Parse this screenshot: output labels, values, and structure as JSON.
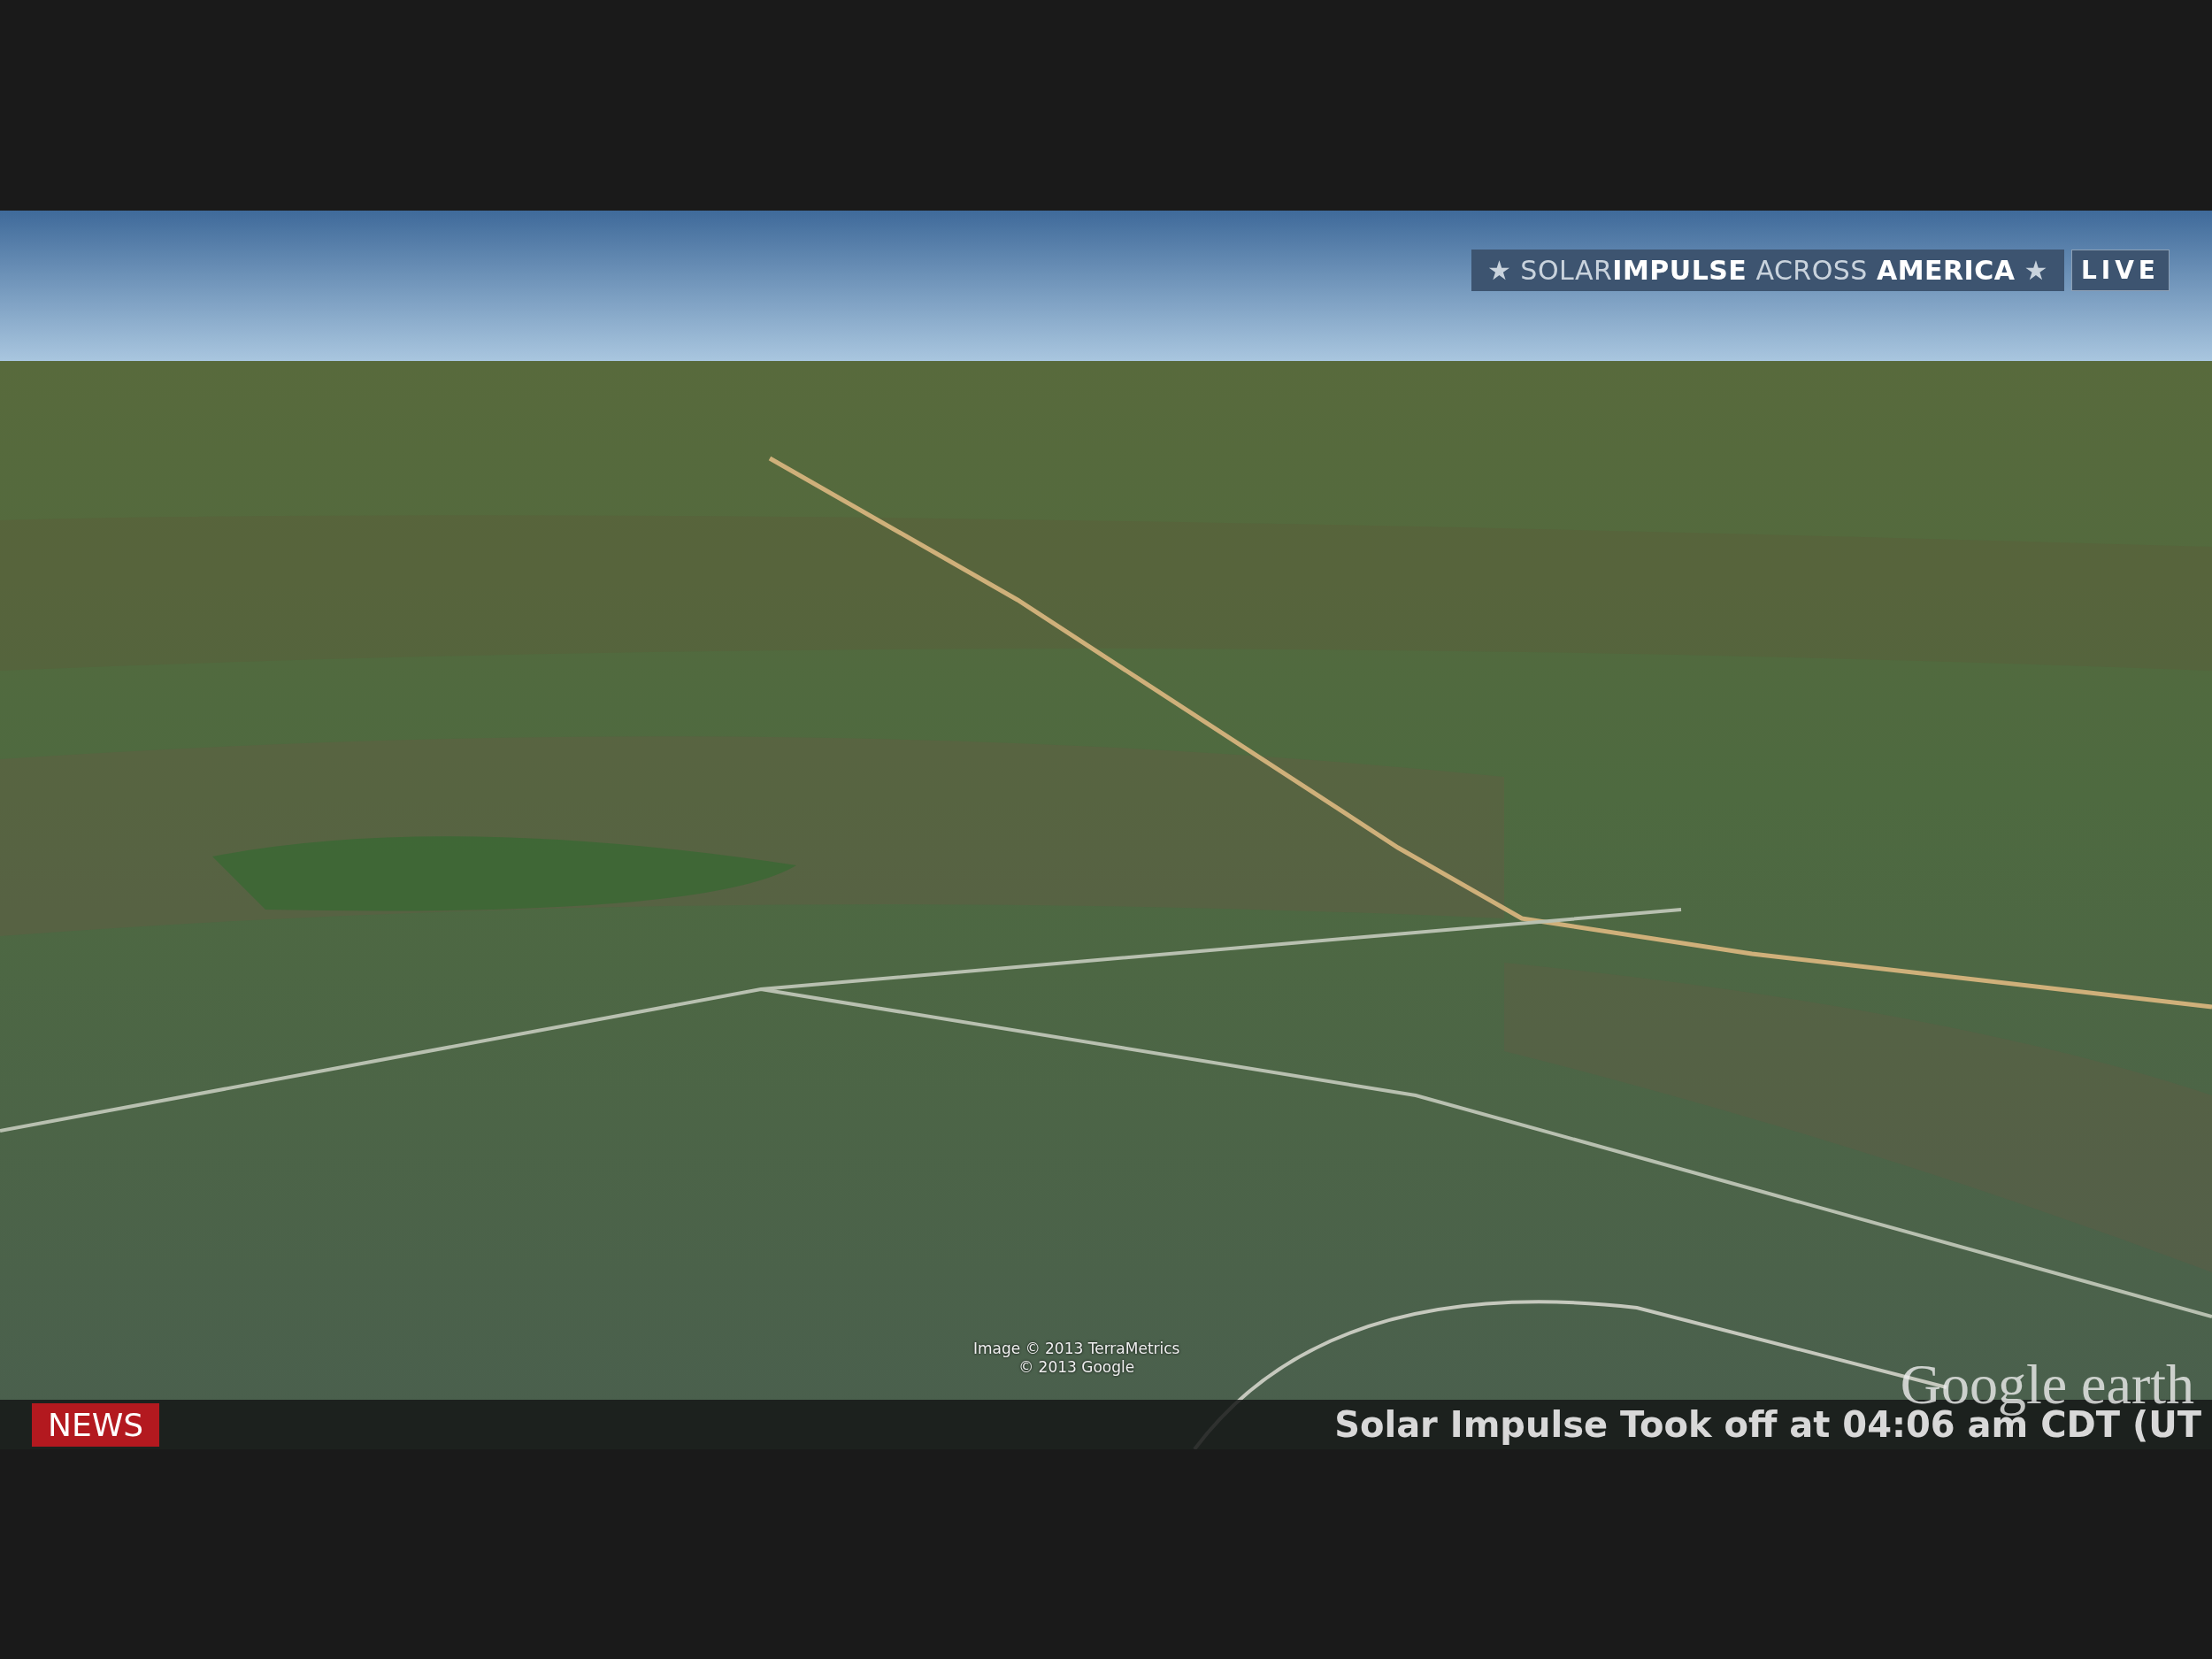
{
  "banner": {
    "title": "★ SOLAR**IMPULSE** ACROSS **AMERICA** ★",
    "badge": "LIVE"
  },
  "attribution": [
    "Image © 2013 TerraMetrics",
    "© 2013 Google"
  ],
  "logo": "Google earth",
  "ticker": {
    "label": "NEWS",
    "text": "Solar Impulse Took off at 04:06 am CDT (UT"
  }
}
